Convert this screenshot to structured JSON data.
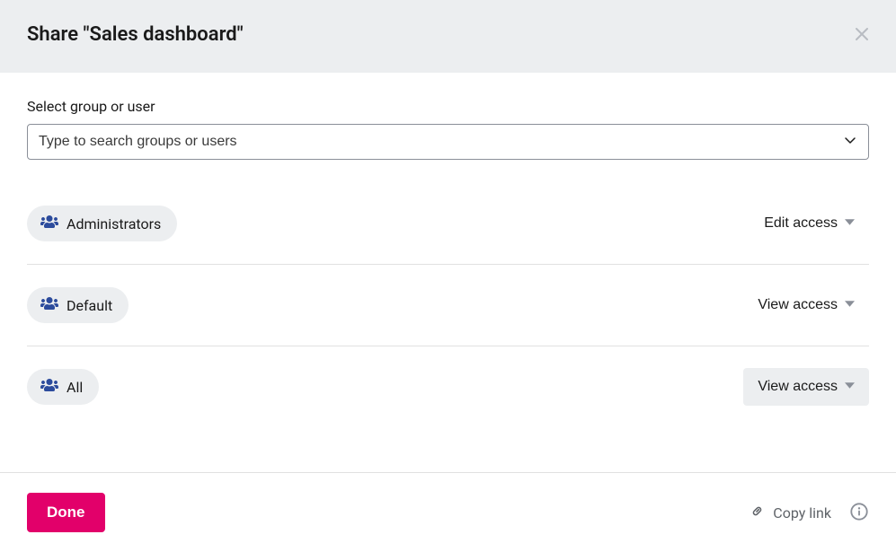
{
  "header": {
    "title": "Share \"Sales dashboard\""
  },
  "search": {
    "label": "Select group or user",
    "placeholder": "Type to search groups or users",
    "value": ""
  },
  "shares": [
    {
      "group": "Administrators",
      "access": "Edit access",
      "highlighted": false
    },
    {
      "group": "Default",
      "access": "View access",
      "highlighted": false
    },
    {
      "group": "All",
      "access": "View access",
      "highlighted": true
    }
  ],
  "footer": {
    "done_label": "Done",
    "copy_link_label": "Copy link"
  },
  "colors": {
    "accent": "#e2006a",
    "icon_blue": "#2c4b9c"
  }
}
